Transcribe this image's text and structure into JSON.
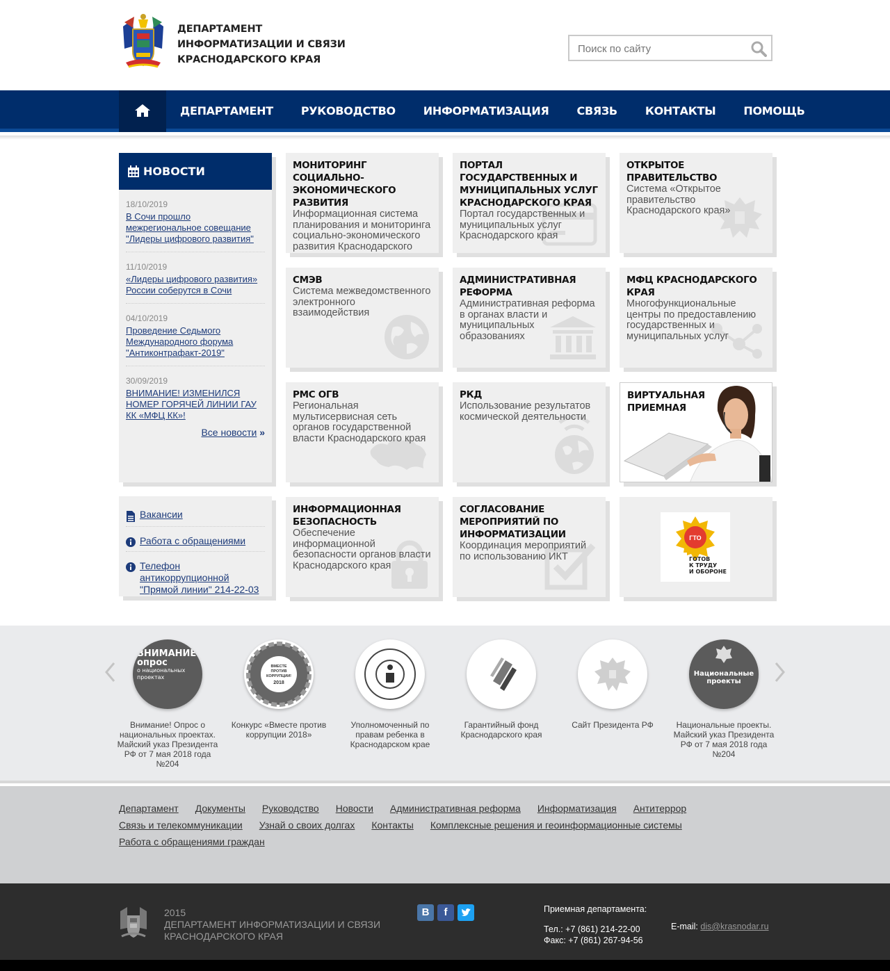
{
  "header": {
    "title_lines": [
      "ДЕПАРТАМЕНТ",
      "ИНФОРМАТИЗАЦИИ И СВЯЗИ",
      "КРАСНОДАРСКОГО КРАЯ"
    ],
    "search_placeholder": "Поиск по сайту"
  },
  "nav": {
    "home_icon": "home-icon",
    "items": [
      "ДЕПАРТАМЕНТ",
      "РУКОВОДСТВО",
      "ИНФОРМАТИЗАЦИЯ",
      "СВЯЗЬ",
      "КОНТАКТЫ",
      "ПОМОЩЬ"
    ]
  },
  "news": {
    "title": "НОВОСТИ",
    "items": [
      {
        "date": "18/10/2019",
        "text": "В Сочи прошло межрегиональное совещание \"Лидеры цифрового развития\""
      },
      {
        "date": "11/10/2019",
        "text": "«Лидеры цифрового развития» России соберутся в Сочи"
      },
      {
        "date": "04/10/2019",
        "text": "Проведение Седьмого Международного форума \"Антиконтрафакт-2019\""
      },
      {
        "date": "30/09/2019",
        "text": "ВНИМАНИЕ! ИЗМЕНИЛСЯ НОМЕР ГОРЯЧЕЙ ЛИНИИ ГАУ КК «МФЦ КК»!"
      }
    ],
    "all_label": "Все новости",
    "all_arrow": "»"
  },
  "side_links": [
    {
      "icon": "document-icon",
      "text": "Вакансии"
    },
    {
      "icon": "info-icon",
      "text": "Работа с обращениями"
    },
    {
      "icon": "info-icon",
      "text": "Телефон антикоррупционной \"Прямой линии\" 214-22-03"
    }
  ],
  "tiles": [
    {
      "title": "МОНИТОРИНГ СОЦИАЛЬНО-ЭКОНОМИЧЕСКОГО РАЗВИТИЯ",
      "desc": "Информационная система планирования и мониторинга социально-экономического развития Краснодарского края",
      "icon": "chart-icon"
    },
    {
      "title": "ПОРТАЛ ГОСУДАРСТВЕННЫХ И МУНИЦИПАЛЬНЫХ УСЛУГ КРАСНОДАРСКОГО КРАЯ",
      "desc": "Портал государственных и муниципальных услуг Краснодарского края",
      "icon": "card-icon"
    },
    {
      "title": "ОТКРЫТОЕ ПРАВИТЕЛЬСТВО",
      "desc": "Система «Открытое правительство Краснодарского края»",
      "icon": "eagle-icon"
    },
    {
      "title": "СМЭВ",
      "desc": "Система межведомственного электронного взаимодействия",
      "icon": "globe-icon"
    },
    {
      "title": "АДМИНИСТРАТИВНАЯ РЕФОРМА",
      "desc": "Административная реформа в органах власти и муниципальных образованиях",
      "icon": "institution-icon"
    },
    {
      "title": "МФЦ КРАСНОДАРСКОГО КРАЯ",
      "desc": "Многофункциональные центры по предоставлению государственных и муниципальных услуг",
      "icon": "network-icon"
    },
    {
      "title": "РМС ОГВ",
      "desc": "Региональная мультисервисная сеть органов государственной власти Краснодарского края",
      "icon": "map-icon"
    },
    {
      "title": "РКД",
      "desc": "Использование результатов космической деятельности",
      "icon": "satellite-icon"
    },
    {
      "title": "ВИРТУАЛЬНАЯ ПРИЕМНАЯ",
      "desc": "",
      "icon": "operator-icon"
    },
    {
      "title": "ИНФОРМАЦИОННАЯ БЕЗОПАСНОСТЬ",
      "desc": "Обеспечение информационной безопасности органов власти Краснодарского края",
      "icon": "lock-icon"
    },
    {
      "title": "СОГЛАСОВАНИЕ МЕРОПРИЯТИЙ ПО ИНФОРМАТИЗАЦИИ",
      "desc": "Координация мероприятий по использованию ИКТ",
      "icon": "checkbox-icon"
    }
  ],
  "gto": {
    "badge": "ГТО",
    "text_lines": [
      "ГОТОВ",
      "К ТРУДУ",
      "И ОБОРОНЕ"
    ]
  },
  "partners": [
    {
      "caption": "Внимание! Опрос о национальных проектах. Майский указ Президента РФ от 7 мая 2018 года №204",
      "logo_lines": [
        "ВНИМАНИЕ!",
        "опрос",
        "о национальных",
        "проектах"
      ]
    },
    {
      "caption": "Конкурс «Вместе против коррупции 2018»",
      "logo_lines": [
        "ВМЕСТЕ",
        "ПРОТИВ",
        "КОРРУПЦИИ!",
        "2018"
      ]
    },
    {
      "caption": "Уполномоченный по правам ребенка в Краснодарском крае",
      "logo_lines": []
    },
    {
      "caption": "Гарантийный фонд Краснодарского края",
      "logo_lines": []
    },
    {
      "caption": "Сайт Президента РФ",
      "logo_lines": []
    },
    {
      "caption": "Национальные проекты. Майский указ Президента РФ от 7 мая 2018 года №204",
      "logo_lines": [
        "Национальные",
        "проекты"
      ]
    }
  ],
  "footer_links": {
    "row1": [
      "Департамент",
      "Документы",
      "Руководство",
      "Новости",
      "Административная реформа",
      "Информатизация",
      "Антитеррор"
    ],
    "row2": [
      "Связь и телекоммуникации",
      "Узнай о своих долгах",
      "Контакты",
      "Комплексные решения и геоинформационные системы"
    ],
    "row3": [
      "Работа с обращениями граждан"
    ]
  },
  "bottom": {
    "year": "2015",
    "org_lines": [
      "ДЕПАРТАМЕНТ ИНФОРМАТИЗАЦИИ И СВЯЗИ",
      "КРАСНОДАРСКОГО КРАЯ"
    ],
    "social": [
      "В",
      "f"
    ],
    "reception_label": "Приемная департамента:",
    "phone": "Тел.: +7 (861) 214-22-00",
    "fax": "Факс: +7 (861) 267-94-56",
    "email_label": "E-mail:",
    "email": "dis@krasnodar.ru"
  },
  "colors": {
    "nav_bg": "#002d6b",
    "nav_home": "#01214f",
    "link": "#1d3b7a",
    "tile_bg": "#efefef",
    "footer_bg": "#2d2d2d"
  }
}
